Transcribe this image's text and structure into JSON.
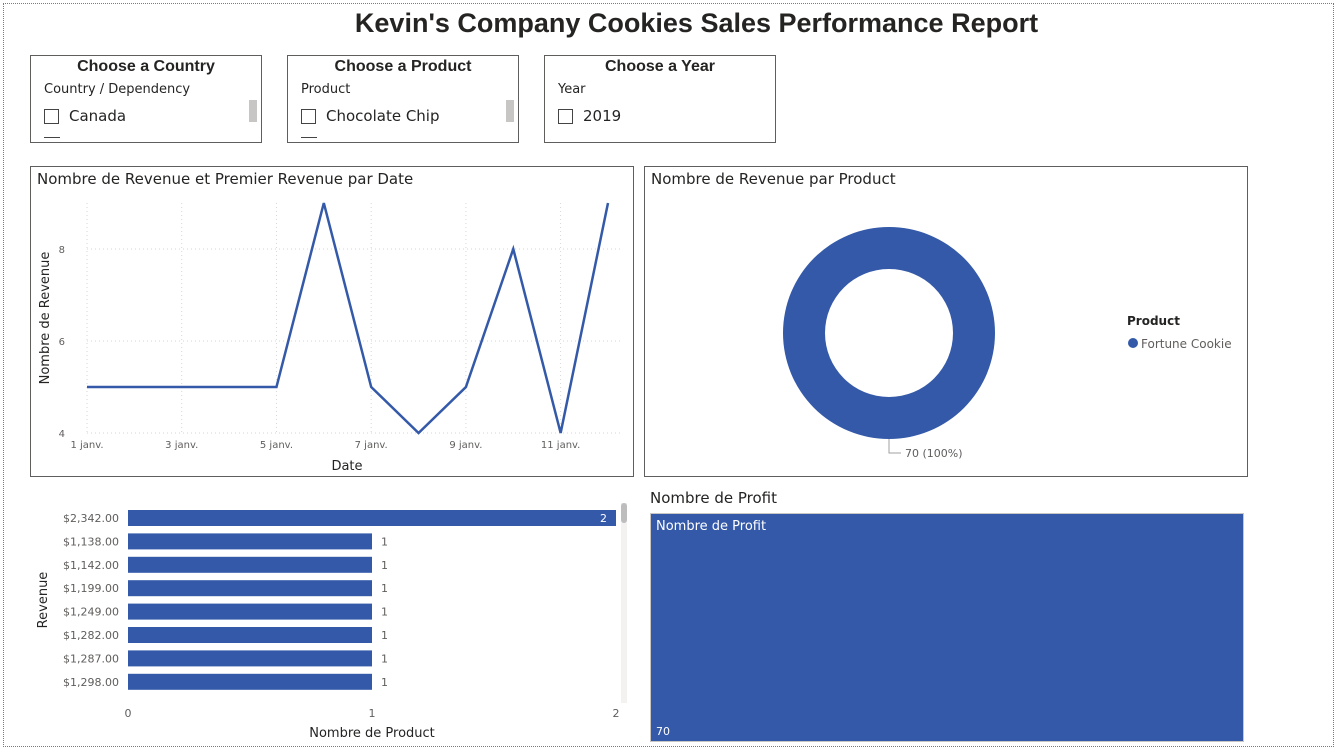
{
  "report": {
    "title": "Kevin's Company Cookies Sales Performance Report"
  },
  "slicers": [
    {
      "header": "Choose a Country",
      "field": "Country / Dependency",
      "item": "Canada"
    },
    {
      "header": "Choose a Product",
      "field": "Product",
      "item": "Chocolate Chip"
    },
    {
      "header": "Choose a Year",
      "field": "Year",
      "item": "2019"
    }
  ],
  "line_chart": {
    "title": "Nombre de Revenue et Premier Revenue par Date"
  },
  "donut_chart": {
    "title": "Nombre de Revenue par Product",
    "legend_title": "Product"
  },
  "bar_chart": {
    "title": ""
  },
  "treemap": {
    "header": "Nombre de Profit",
    "label": "Nombre de Profit",
    "value": "70"
  },
  "colors": {
    "series": "#3359a8",
    "axis_text": "#605e5c"
  },
  "chart_data": [
    {
      "type": "line",
      "title": "Nombre de Revenue et Premier Revenue par Date",
      "xlabel": "Date",
      "ylabel": "Nombre de Revenue",
      "x": [
        "1 janv.",
        "2 janv.",
        "3 janv.",
        "4 janv.",
        "5 janv.",
        "6 janv.",
        "7 janv.",
        "8 janv.",
        "9 janv.",
        "10 janv.",
        "11 janv.",
        "12 janv."
      ],
      "x_ticks": [
        "1 janv.",
        "3 janv.",
        "5 janv.",
        "7 janv.",
        "9 janv.",
        "11 janv."
      ],
      "y_ticks": [
        "4",
        "6",
        "8"
      ],
      "series": [
        {
          "values": [
            5,
            5,
            5,
            5,
            5,
            9,
            5,
            4,
            5,
            8,
            4,
            9
          ]
        }
      ],
      "ylim": [
        4,
        9
      ],
      "grid": true
    },
    {
      "type": "pie",
      "title": "Nombre de Revenue par Product",
      "legend_title": "Product",
      "legend_position": "right",
      "categories": [
        "Fortune Cookie"
      ],
      "values": [
        70
      ],
      "labels": [
        "70 (100%)"
      ]
    },
    {
      "type": "bar",
      "orientation": "horizontal",
      "xlabel": "Nombre de Product",
      "ylabel": "Revenue",
      "categories": [
        "$2,342.00",
        "$1,138.00",
        "$1,142.00",
        "$1,199.00",
        "$1,249.00",
        "$1,282.00",
        "$1,287.00",
        "$1,298.00"
      ],
      "values": [
        2,
        1,
        1,
        1,
        1,
        1,
        1,
        1
      ],
      "x_ticks": [
        "0",
        "1",
        "2"
      ],
      "xlim": [
        0,
        2
      ]
    }
  ]
}
